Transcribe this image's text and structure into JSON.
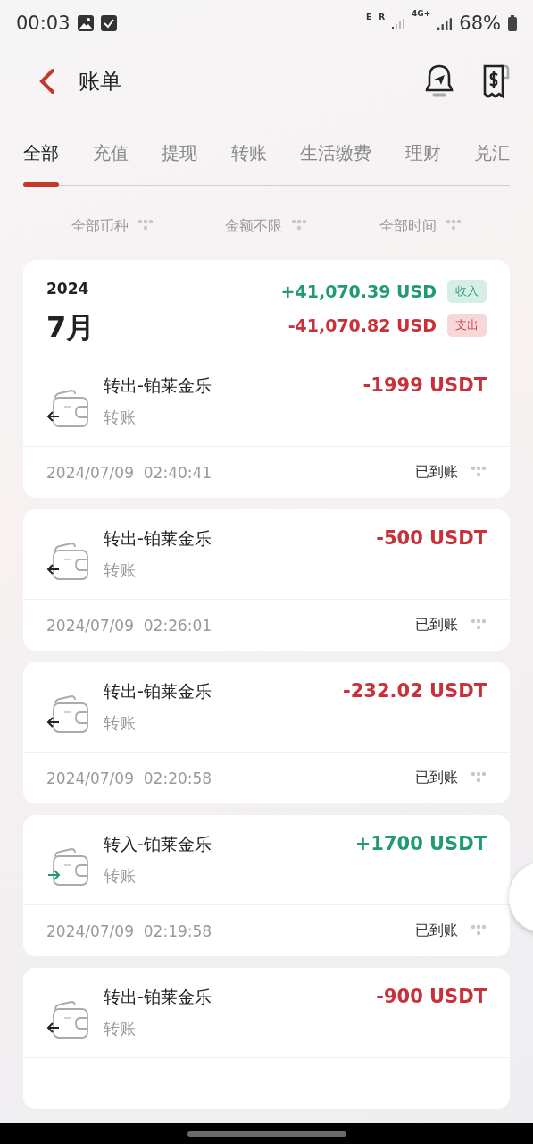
{
  "status_bar": {
    "time": "00:03",
    "sim_1": "E",
    "sim_2": "R",
    "network": "4G+",
    "battery": "68%"
  },
  "header": {
    "title": "账单"
  },
  "tabs": [
    {
      "label": "全部",
      "selected": true
    },
    {
      "label": "充值",
      "selected": false
    },
    {
      "label": "提现",
      "selected": false
    },
    {
      "label": "转账",
      "selected": false
    },
    {
      "label": "生活缴费",
      "selected": false
    },
    {
      "label": "理财",
      "selected": false
    },
    {
      "label": "兑汇",
      "selected": false
    }
  ],
  "filters": [
    {
      "label": "全部币种"
    },
    {
      "label": "金额不限"
    },
    {
      "label": "全部时间"
    }
  ],
  "summary": {
    "year": "2024",
    "month": "7月",
    "totals": [
      {
        "kind": "income",
        "amount": "+41,070.39 USD",
        "badge": "收入"
      },
      {
        "kind": "expense",
        "amount": "-41,070.82 USD",
        "badge": "支出"
      }
    ]
  },
  "transactions": [
    {
      "kind": "out",
      "title": "转出-铂莱金乐",
      "category": "转账",
      "amount": "-1999 USDT",
      "date": "2024/07/09",
      "time": "02:40:41",
      "status": "已到账"
    },
    {
      "kind": "out",
      "title": "转出-铂莱金乐",
      "category": "转账",
      "amount": "-500 USDT",
      "date": "2024/07/09",
      "time": "02:26:01",
      "status": "已到账"
    },
    {
      "kind": "out",
      "title": "转出-铂莱金乐",
      "category": "转账",
      "amount": "-232.02 USDT",
      "date": "2024/07/09",
      "time": "02:20:58",
      "status": "已到账"
    },
    {
      "kind": "in",
      "title": "转入-铂莱金乐",
      "category": "转账",
      "amount": "+1700 USDT",
      "date": "2024/07/09",
      "time": "02:19:58",
      "status": "已到账"
    },
    {
      "kind": "out",
      "title": "转出-铂莱金乐",
      "category": "转账",
      "amount": "-900 USDT"
    }
  ]
}
